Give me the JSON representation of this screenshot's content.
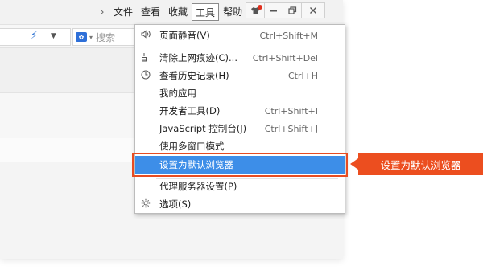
{
  "menubar": {
    "items": [
      "文件",
      "查看",
      "收藏",
      "工具",
      "帮助"
    ],
    "active_index": 3
  },
  "window_controls": {
    "skin": "tshirt-icon",
    "minimize": "minimize-icon",
    "restore": "restore-icon",
    "close": "close-icon"
  },
  "toolbar": {
    "search_placeholder": "搜索",
    "accent_color": "#3a7bd5"
  },
  "tools_menu": {
    "items": [
      {
        "label": "页面静音(V)",
        "shortcut": "Ctrl+Shift+M",
        "icon": "speaker-icon"
      },
      {
        "label": "清除上网痕迹(C)...",
        "shortcut": "Ctrl+Shift+Del",
        "icon": "broom-icon"
      },
      {
        "label": "查看历史记录(H)",
        "shortcut": "Ctrl+H",
        "icon": "clock-icon"
      },
      {
        "label": "我的应用",
        "shortcut": "",
        "icon": ""
      },
      {
        "label": "开发者工具(D)",
        "shortcut": "Ctrl+Shift+I",
        "icon": ""
      },
      {
        "label": "JavaScript 控制台(J)",
        "shortcut": "Ctrl+Shift+J",
        "icon": ""
      },
      {
        "label": "使用多窗口模式",
        "shortcut": "",
        "icon": ""
      },
      {
        "label": "设置为默认浏览器",
        "shortcut": "",
        "icon": "",
        "selected": true
      },
      {
        "label": "代理服务器设置(P)",
        "shortcut": "",
        "icon": ""
      },
      {
        "label": "选项(S)",
        "shortcut": "",
        "icon": "gear-icon"
      }
    ],
    "highlight_color": "#3d8ee8"
  },
  "callout": {
    "text": "设置为默认浏览器",
    "color": "#ec4e1f"
  }
}
